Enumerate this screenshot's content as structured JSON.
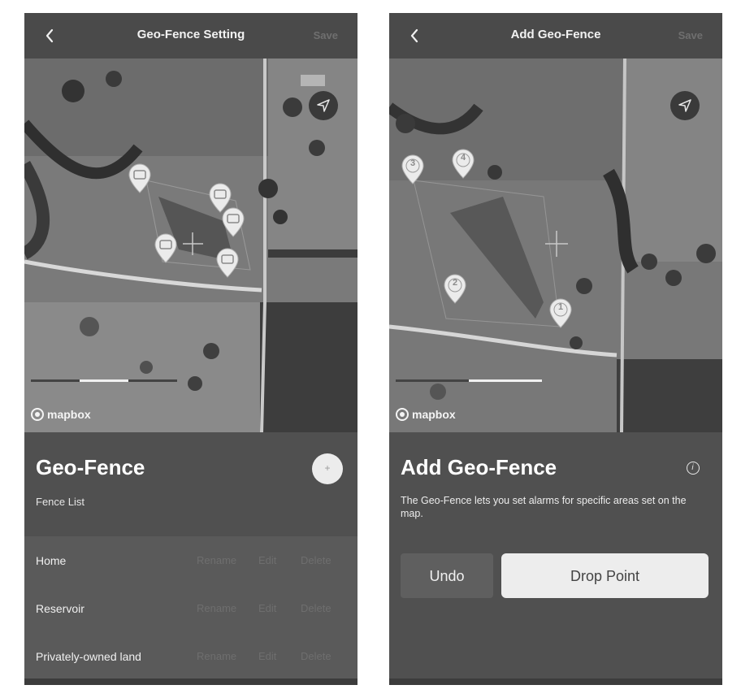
{
  "left_screen": {
    "header": {
      "back_icon": "chevron-left-icon",
      "title": "Geo-Fence Setting",
      "save_label": "Save"
    },
    "map": {
      "attribution": "mapbox",
      "locate_icon": "navigation-arrow-icon",
      "fence_pin_count": 5
    },
    "panel": {
      "title": "Geo-Fence",
      "subtitle": "Fence List",
      "add_button_label": "+",
      "fences": [
        {
          "name": "Home",
          "rename": "Rename",
          "edit": "Edit",
          "delete": "Delete"
        },
        {
          "name": "Reservoir",
          "rename": "Rename",
          "edit": "Edit",
          "delete": "Delete"
        },
        {
          "name": "Privately-owned land",
          "rename": "Rename",
          "edit": "Edit",
          "delete": "Delete"
        }
      ]
    }
  },
  "right_screen": {
    "header": {
      "back_icon": "chevron-left-icon",
      "title": "Add Geo-Fence",
      "save_label": "Save"
    },
    "map": {
      "attribution": "mapbox",
      "locate_icon": "navigation-arrow-icon",
      "points": [
        "1",
        "2",
        "3",
        "4"
      ]
    },
    "panel": {
      "title": "Add Geo-Fence",
      "info_icon": "info-icon",
      "info_label": "i",
      "description": "The Geo-Fence lets you set alarms for specific areas set on the map.",
      "undo_label": "Undo",
      "drop_point_label": "Drop Point"
    }
  },
  "colors": {
    "topbar": "#4a4a4a",
    "panel": "#505050",
    "list_bg": "#5a5a5a",
    "primary_button": "#ededed",
    "secondary_button": "#5f5f5f"
  }
}
